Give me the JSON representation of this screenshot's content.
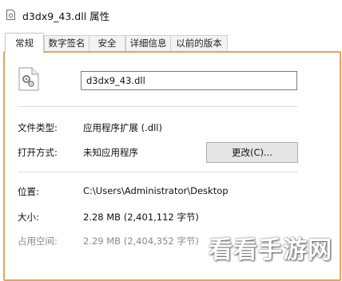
{
  "window": {
    "title": "d3dx9_43.dll 属性"
  },
  "tabs": [
    {
      "label": "常规",
      "active": true
    },
    {
      "label": "数字签名",
      "active": false
    },
    {
      "label": "安全",
      "active": false
    },
    {
      "label": "详细信息",
      "active": false
    },
    {
      "label": "以前的版本",
      "active": false
    }
  ],
  "general": {
    "file_name": "d3dx9_43.dll",
    "file_icon": "gear-file-icon",
    "file_type_label": "文件类型:",
    "file_type_value": "应用程序扩展 (.dll)",
    "opens_with_label": "打开方式:",
    "opens_with_value": "未知应用程序",
    "change_button": "更改(C)...",
    "location_label": "位置:",
    "location_value": "C:\\Users\\Administrator\\Desktop",
    "size_label": "大小:",
    "size_value": "2.28 MB (2,401,112 字节)",
    "size_on_disk_label": "占用空间:",
    "size_on_disk_value": "2.29 MB (2,404,352 字节)"
  },
  "watermark": {
    "text": "看看手游网"
  },
  "colors": {
    "panel_edge": "#e7a35c",
    "button_bg": "#e5e5e5"
  }
}
